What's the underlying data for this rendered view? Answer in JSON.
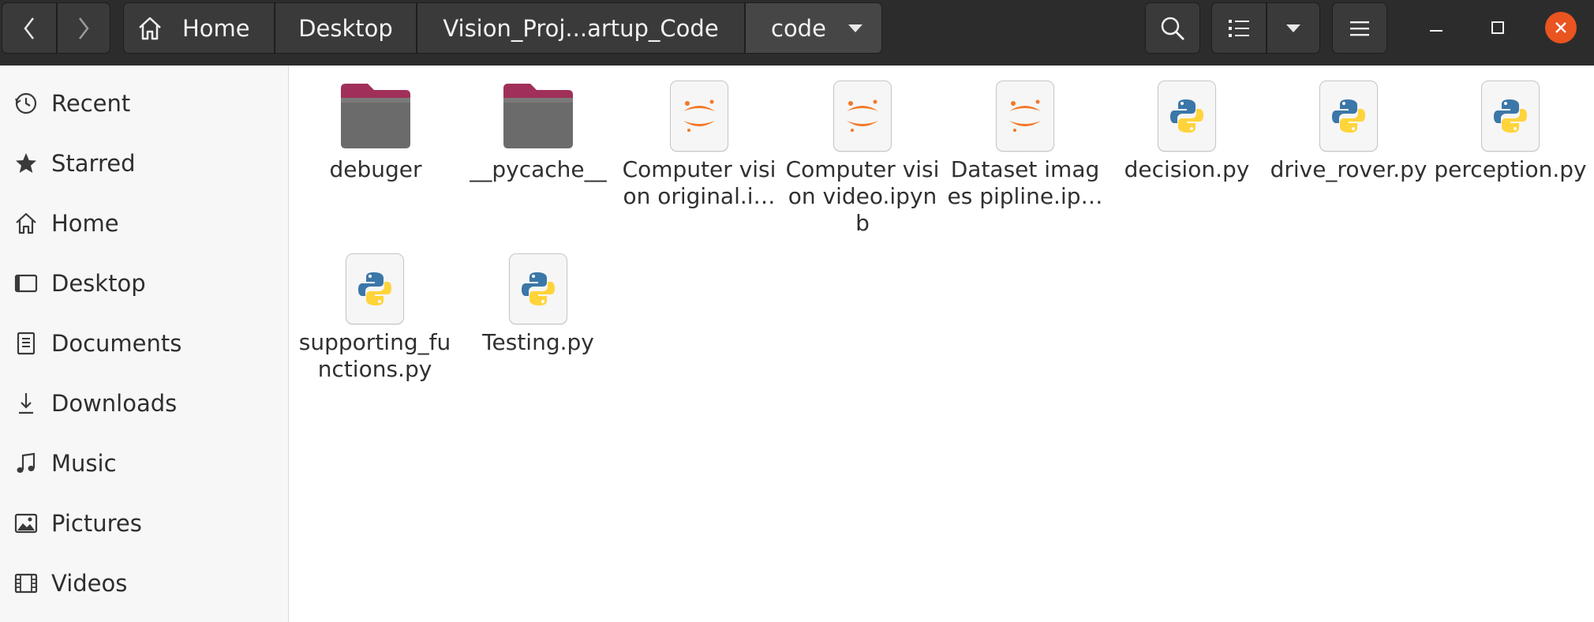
{
  "nav": {
    "back_icon": "chevron-left-icon",
    "forward_icon": "chevron-right-icon"
  },
  "breadcrumb": {
    "home_icon": "home-icon",
    "items": [
      "Home",
      "Desktop",
      "Vision_Proj...artup_Code",
      "code"
    ],
    "dropdown_icon": "caret-down-icon"
  },
  "toolbar": {
    "search_icon": "search-icon",
    "view_icon": "list-view-icon",
    "view_dropdown_icon": "caret-down-icon",
    "menu_icon": "hamburger-icon"
  },
  "window": {
    "minimize_icon": "minimize-icon",
    "maximize_icon": "maximize-icon",
    "close_icon": "close-icon",
    "close_color": "#e95420"
  },
  "sidebar": {
    "items": [
      {
        "label": "Recent",
        "icon": "clock-icon"
      },
      {
        "label": "Starred",
        "icon": "star-icon"
      },
      {
        "label": "Home",
        "icon": "home-icon"
      },
      {
        "label": "Desktop",
        "icon": "desktop-icon"
      },
      {
        "label": "Documents",
        "icon": "document-icon"
      },
      {
        "label": "Downloads",
        "icon": "download-icon"
      },
      {
        "label": "Music",
        "icon": "music-icon"
      },
      {
        "label": "Pictures",
        "icon": "image-icon"
      },
      {
        "label": "Videos",
        "icon": "film-icon"
      }
    ]
  },
  "files": [
    {
      "name": "debuger",
      "type": "folder",
      "icon": "folder-icon"
    },
    {
      "name": "__pycache__",
      "type": "folder",
      "icon": "folder-icon"
    },
    {
      "name": "Computer vision original.i…",
      "type": "notebook",
      "icon": "jupyter-icon"
    },
    {
      "name": "Computer vision video.ipynb",
      "type": "notebook",
      "icon": "jupyter-icon"
    },
    {
      "name": "Dataset images pipline.ip…",
      "type": "notebook",
      "icon": "jupyter-icon"
    },
    {
      "name": "decision.py",
      "type": "python",
      "icon": "python-icon"
    },
    {
      "name": "drive_rover.py",
      "type": "python",
      "icon": "python-icon"
    },
    {
      "name": "perception.py",
      "type": "python",
      "icon": "python-icon"
    },
    {
      "name": "supporting_functions.py",
      "type": "python",
      "icon": "python-icon"
    },
    {
      "name": "Testing.py",
      "type": "python",
      "icon": "python-icon"
    }
  ],
  "colors": {
    "header_bg": "#2c2c2c",
    "folder_tab": "#a0305a",
    "jupyter_orange": "#f37726",
    "python_blue": "#3b77a8",
    "python_yellow": "#ffd43b"
  }
}
